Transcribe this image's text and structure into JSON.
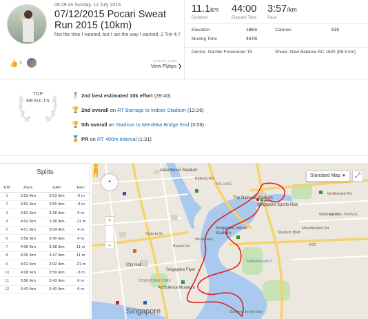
{
  "activity": {
    "date": "06:29 on Sunday, 12 July 2015",
    "title": "07/12/2015 Pocari Sweat Run 2015 (10km)",
    "description": "Not the time I wanted, but I ran the way I wanted. 2 Tim 4:7",
    "kudos_count": "1",
    "strava_labs": "STRAVA LABS",
    "view_flybys": "View Flybys ❯"
  },
  "stats": {
    "distance_value": "11.1",
    "distance_unit": "km",
    "distance_label": "Distance",
    "elapsed_value": "44:00",
    "elapsed_label": "Elapsed Time",
    "pace_value": "3:57",
    "pace_unit": "/km",
    "pace_label": "Pace",
    "elevation_label": "Elevation",
    "elevation_value": "186m",
    "calories_label": "Calories",
    "calories_value": "819",
    "moving_label": "Moving Time",
    "moving_value": "44:00",
    "device": "Device: Garmin Forerunner 15",
    "shoes": "Shoes: New Balance RC 1600 (98.3 km)"
  },
  "results": {
    "heading_line1": "TOP",
    "heading_line2": "RESULTS",
    "items": [
      {
        "icon": "medal-icon",
        "bold": "2nd best estimated 10k effort",
        "pre": "",
        "link": "",
        "post": " (39:40)",
        "color": "#8a8a8a"
      },
      {
        "icon": "trophy-icon",
        "bold": "2nd overall",
        "pre": " on ",
        "link": "RT Barrage to Indoor Stadium",
        "post": " (12:26)",
        "color": "#d9a400"
      },
      {
        "icon": "trophy-icon",
        "bold": "5th overall",
        "pre": " on ",
        "link": "Stadium to Merdeka Bridge End",
        "post": " (3:56)",
        "color": "#d9a400"
      },
      {
        "icon": "pr-medal-icon",
        "bold": "PR",
        "pre": " on ",
        "link": "RT 400m Interval",
        "post": " (1:31)",
        "color": "#e2a800"
      }
    ]
  },
  "splits": {
    "title": "Splits",
    "headers": [
      "KM",
      "Pace",
      "GAP",
      "Elev"
    ],
    "rows": [
      [
        "1",
        "3:53 /km",
        "3:53 /km",
        "-2 m"
      ],
      [
        "2",
        "3:52 /km",
        "3:55 /km",
        "-4 m"
      ],
      [
        "3",
        "3:52 /km",
        "3:38 /km",
        "6 m"
      ],
      [
        "4",
        "4:02 /km",
        "3:38 /km",
        "-11 m"
      ],
      [
        "5",
        "4:01 /km",
        "3:54 /km",
        "4 m"
      ],
      [
        "6",
        "3:56 /km",
        "3:45 /km",
        "4 m"
      ],
      [
        "7",
        "4:00 /km",
        "3:38 /km",
        "11 m"
      ],
      [
        "8",
        "4:00 /km",
        "3:47 /km",
        "11 m"
      ],
      [
        "9",
        "4:02 /km",
        "3:02 /km",
        "-21 m"
      ],
      [
        "10",
        "4:08 /km",
        "3:59 /km",
        "-3 m"
      ],
      [
        "11",
        "3:50 /km",
        "3:43 /km",
        "6 m"
      ],
      [
        "12",
        "3:43 /km",
        "3:40 /km",
        "6 m"
      ]
    ]
  },
  "map": {
    "map_type": "Standard Map",
    "labels": [
      {
        "text": "Jalan Besar Stadium",
        "kind": "place"
      },
      {
        "text": "Singapore Indoor Stadium",
        "kind": "place"
      },
      {
        "text": "The National Stadium",
        "kind": "place"
      },
      {
        "text": "Singapore Sports Hub",
        "kind": "place"
      },
      {
        "text": "City Hall",
        "kind": "place"
      },
      {
        "text": "Singapore Flyer",
        "kind": "place"
      },
      {
        "text": "ArtScience Museum",
        "kind": "place"
      },
      {
        "text": "DOWNTOWN CORE",
        "kind": "district"
      },
      {
        "text": "MARINA EAST",
        "kind": "district"
      },
      {
        "text": "MARINE PARADE",
        "kind": "district"
      },
      {
        "text": "KALLANG",
        "kind": "district"
      },
      {
        "text": "Singapore",
        "kind": "city"
      },
      {
        "text": "Gardens by the Bay",
        "kind": "park"
      },
      {
        "text": "Guillemard Rd",
        "kind": "road"
      },
      {
        "text": "Mountbatten Rd",
        "kind": "road"
      },
      {
        "text": "Stadium Blvd",
        "kind": "road"
      },
      {
        "text": "Nicoll Hwy",
        "kind": "road"
      },
      {
        "text": "Beach Rd",
        "kind": "road"
      },
      {
        "text": "Victoria St",
        "kind": "road"
      },
      {
        "text": "Kallang Rd",
        "kind": "road"
      },
      {
        "text": "ECP",
        "kind": "road"
      },
      {
        "text": "Wilkinson Rd",
        "kind": "road"
      }
    ]
  }
}
